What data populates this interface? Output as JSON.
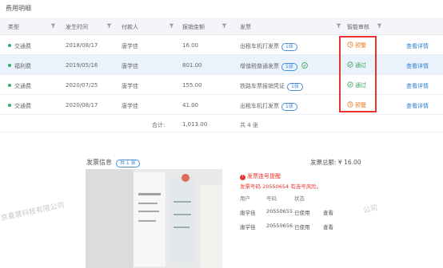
{
  "section_title": "费用明细",
  "columns": [
    "类型",
    "发生时间",
    "付款人",
    "报销金额",
    "发票",
    "智能审核"
  ],
  "rows": [
    {
      "type": "交通费",
      "date": "2018/08/17",
      "payer": "唐学佳",
      "amount": "16.00",
      "invoice": "出租车机打发票",
      "tag": "1张",
      "audit": "预警",
      "audit_status": "warning",
      "action": "查看详情",
      "has_extra_icon": false
    },
    {
      "type": "福利费",
      "date": "2019/05/16",
      "payer": "唐学佳",
      "amount": "801.00",
      "invoice": "增值税普通发票",
      "tag": "1张",
      "audit": "通过",
      "audit_status": "pass",
      "action": "查看详情",
      "has_extra_icon": true
    },
    {
      "type": "交通费",
      "date": "2020/07/25",
      "payer": "唐学佳",
      "amount": "155.00",
      "invoice": "铁路车票报销凭证",
      "tag": "1张",
      "audit": "通过",
      "audit_status": "pass",
      "action": "查看详情",
      "has_extra_icon": false
    },
    {
      "type": "交通费",
      "date": "2020/08/17",
      "payer": "唐学佳",
      "amount": "41.00",
      "invoice": "出租车机打发票",
      "tag": "1张",
      "audit": "预警",
      "audit_status": "warning",
      "action": "查看详情",
      "has_extra_icon": false
    }
  ],
  "totals": {
    "label": "合计:",
    "amount": "1,013.00",
    "count": "共 4 张"
  },
  "invoice_info": {
    "title": "发票信息",
    "tag": "共 1 张",
    "total": "发票总额: ¥ 16.00",
    "alert_title": "发票连号提醒",
    "alert_message": "发票号码 20550654 有连号风险。",
    "sub_columns": [
      "用户",
      "号码",
      "状态"
    ],
    "sub_rows": [
      {
        "user": "唐学佳",
        "number": "20550655",
        "status": "已使用",
        "action": "查看"
      },
      {
        "user": "唐学佳",
        "number": "20550656",
        "status": "已使用",
        "action": "查看"
      }
    ]
  },
  "watermark_left": "京喜慧科技有限公司",
  "watermark_right": "公司",
  "colors": {
    "accent": "#2f7fd1",
    "warning": "#e6781e",
    "pass": "#38a357",
    "alert": "#e8332e",
    "header_bg": "#f3f5f8",
    "highlight_row": "#eaf3fb"
  }
}
